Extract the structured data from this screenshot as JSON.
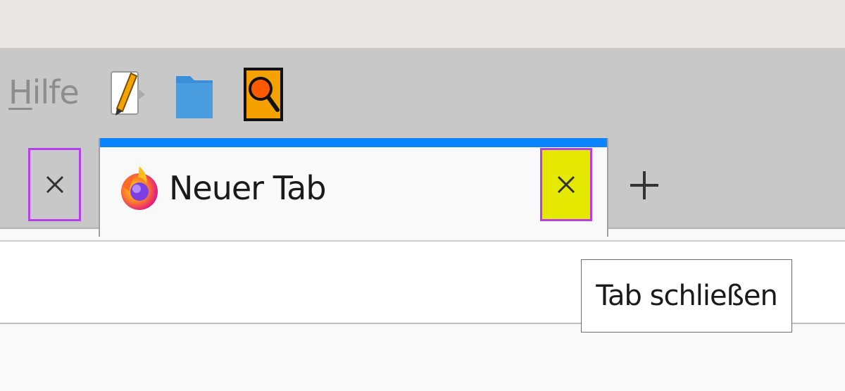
{
  "menubar": {
    "hilfe": {
      "accel": "H",
      "rest": "ilfe"
    }
  },
  "toolbar_icons": [
    {
      "icon": "edit-document-icon"
    },
    {
      "icon": "folder-icon"
    },
    {
      "icon": "search-icon"
    }
  ],
  "tabs": [
    {
      "title": "Neuer Tab",
      "favicon": "firefox-icon",
      "close_icon": "close-icon"
    }
  ],
  "new_tab": {
    "icon": "plus-icon"
  },
  "tooltip": {
    "text": "Tab schließen"
  },
  "colors": {
    "tab_accent": "#0a84ff",
    "highlight_border": "#b53fe8",
    "close_highlight": "#e5e800"
  }
}
